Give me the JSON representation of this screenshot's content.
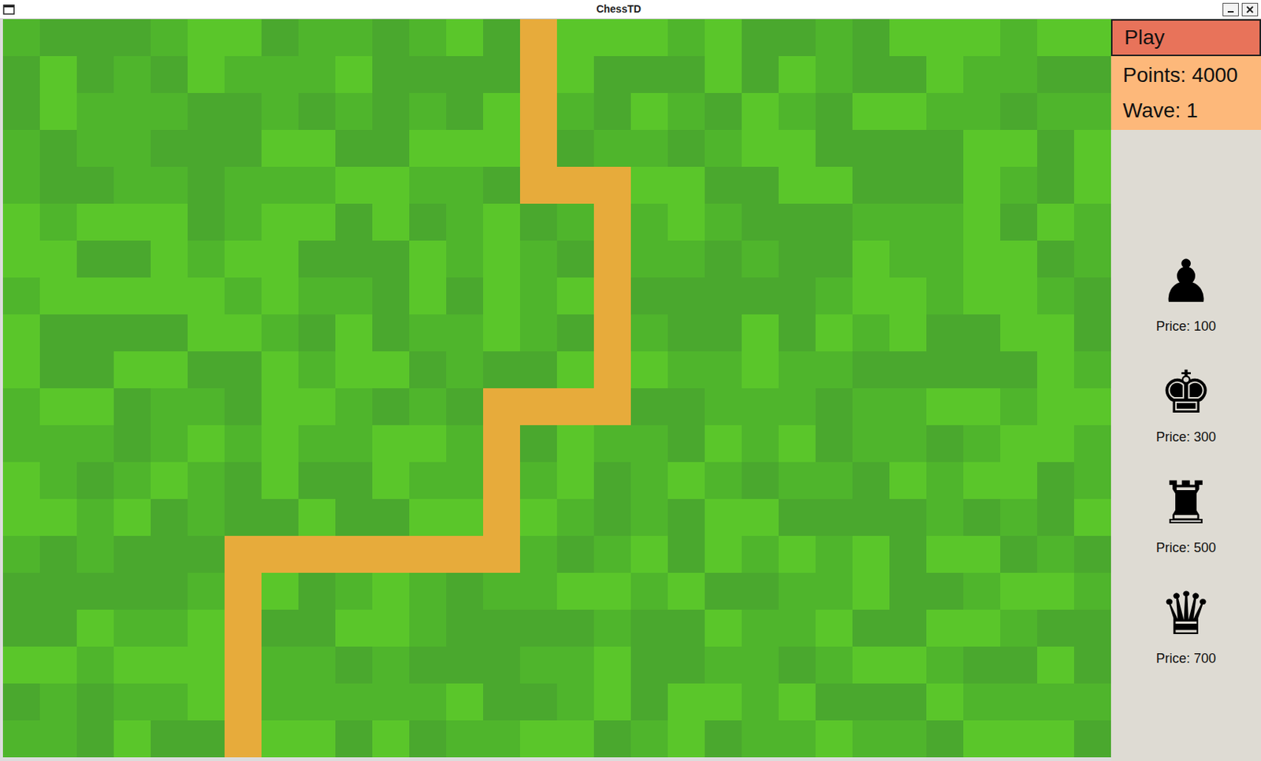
{
  "window": {
    "title": "ChessTD"
  },
  "sidebar": {
    "play": "Play",
    "points": "Points: 4000",
    "wave": "Wave: 1",
    "shop": [
      {
        "glyph": "♟",
        "price": "Price: 100"
      },
      {
        "glyph": "♚",
        "price": "Price: 300"
      },
      {
        "glyph": "♜",
        "price": "Price: 500"
      },
      {
        "glyph": "♛",
        "price": "Price: 700"
      }
    ]
  },
  "board": {
    "rows": [
      "..............#...............",
      "..............#...............",
      "..............#...............",
      "..............#...............",
      "..............###.............",
      "................#.............",
      "................#.............",
      "................#.............",
      "................#.............",
      "................#.............",
      ".............####.............",
      ".............#................",
      ".............#................",
      ".............#................",
      "......########................",
      "......#.......................",
      "......#.......................",
      "......#.......................",
      "......#.......................",
      "......#......................."
    ]
  }
}
